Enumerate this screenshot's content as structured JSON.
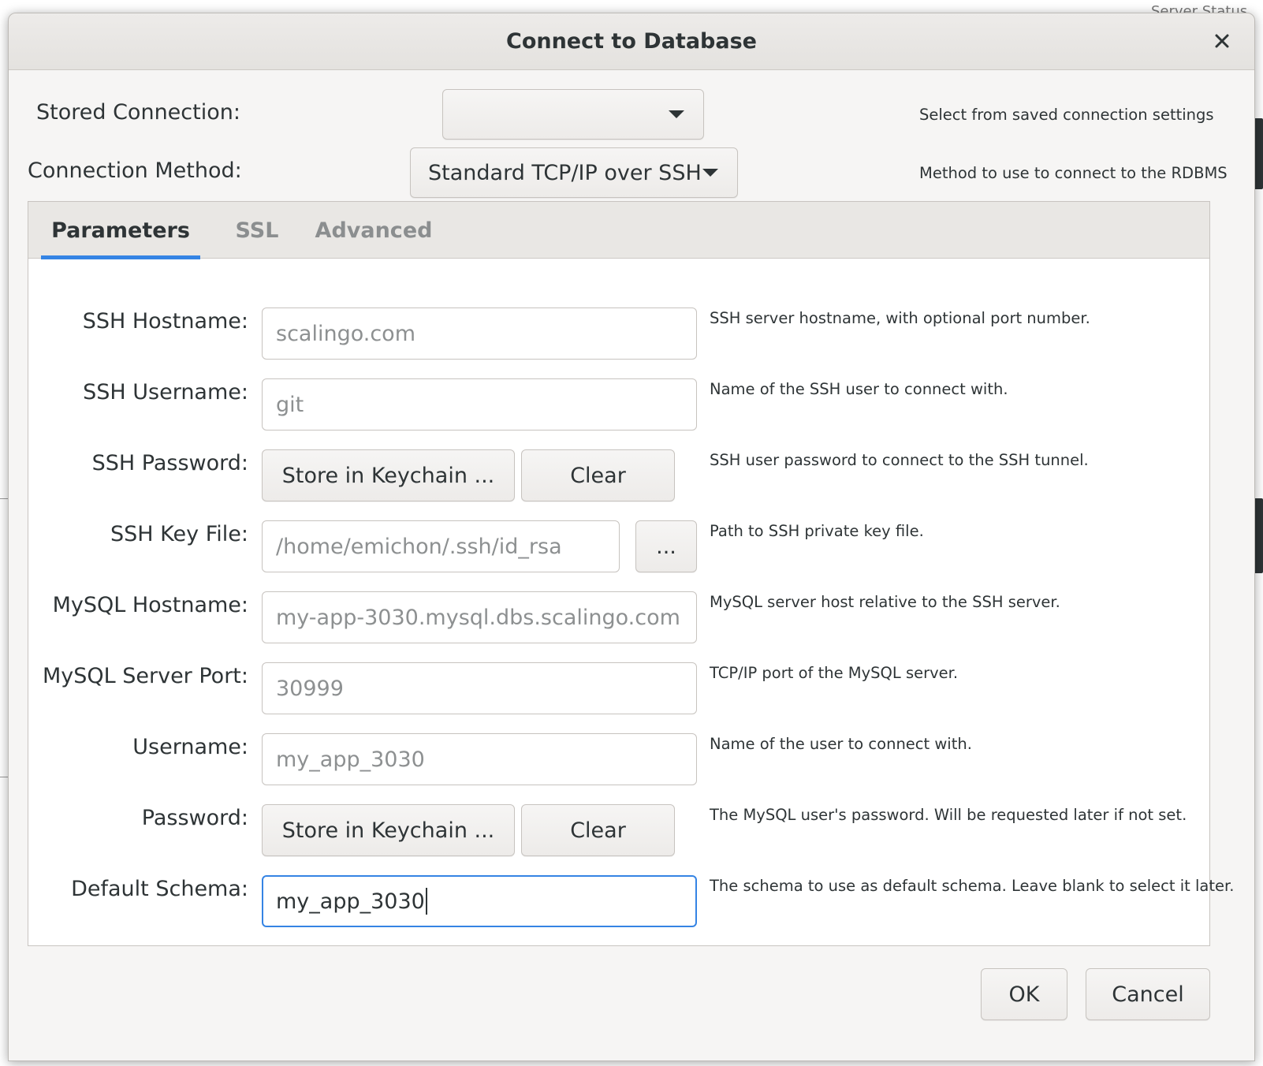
{
  "background": {
    "corner_text": "Server Status"
  },
  "dialog": {
    "title": "Connect to Database",
    "stored_connection": {
      "label": "Stored Connection:",
      "value": "",
      "hint": "Select from saved connection settings"
    },
    "connection_method": {
      "label": "Connection Method:",
      "value": "Standard TCP/IP over SSH",
      "hint": "Method to use to connect to the RDBMS"
    },
    "tabs": [
      {
        "label": "Parameters",
        "active": true
      },
      {
        "label": "SSL",
        "active": false
      },
      {
        "label": "Advanced",
        "active": false
      }
    ],
    "fields": {
      "ssh_hostname": {
        "label": "SSH Hostname:",
        "placeholder": "scalingo.com",
        "hint": "SSH server hostname, with  optional port number."
      },
      "ssh_username": {
        "label": "SSH Username:",
        "placeholder": "git",
        "hint": "Name of the SSH user to connect with."
      },
      "ssh_password": {
        "label": "SSH Password:",
        "store_label": "Store in Keychain ...",
        "clear_label": "Clear",
        "hint": "SSH user password to connect to the SSH tunnel."
      },
      "ssh_key_file": {
        "label": "SSH Key File:",
        "placeholder": "/home/emichon/.ssh/id_rsa",
        "browse_label": "...",
        "hint": "Path to SSH private key file."
      },
      "mysql_hostname": {
        "label": "MySQL Hostname:",
        "placeholder": "my-app-3030.mysql.dbs.scalingo.com",
        "hint": "MySQL server host relative to the SSH server."
      },
      "mysql_port": {
        "label": "MySQL Server Port:",
        "placeholder": "30999",
        "hint": "TCP/IP port of the MySQL server."
      },
      "username": {
        "label": "Username:",
        "placeholder": "my_app_3030",
        "hint": "Name of the user to connect with."
      },
      "password": {
        "label": "Password:",
        "store_label": "Store in Keychain ...",
        "clear_label": "Clear",
        "hint": "The MySQL user's password. Will be requested later if not set."
      },
      "default_schema": {
        "label": "Default Schema:",
        "value": "my_app_3030",
        "hint": "The schema to use as default schema. Leave blank to select it later."
      }
    },
    "buttons": {
      "ok": "OK",
      "cancel": "Cancel"
    },
    "colors": {
      "accent": "#3584e4",
      "dialog_bg": "#f6f5f4",
      "text": "#2e3436",
      "placeholder": "#8d9091"
    },
    "icons": {
      "close": "close-icon",
      "dropdown": "caret-down-icon"
    }
  }
}
